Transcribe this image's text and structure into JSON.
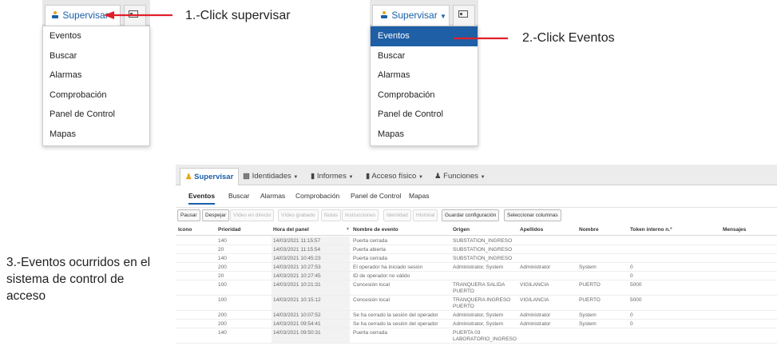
{
  "step1": {
    "supervisar_label": "Supervisar",
    "supervisar_icon": "monitor-person-icon",
    "other_icon": "id-card-icon",
    "menu": [
      "Eventos",
      "Buscar",
      "Alarmas",
      "Comprobación",
      "Panel de Control",
      "Mapas"
    ],
    "annotation": "1.-Click supervisar"
  },
  "step2": {
    "supervisar_label": "Supervisar",
    "supervisar_icon": "monitor-person-icon",
    "other_icon": "id-card-icon",
    "menu": [
      "Eventos",
      "Buscar",
      "Alarmas",
      "Comprobación",
      "Panel de Control",
      "Mapas"
    ],
    "selected_item": "Eventos",
    "annotation": "2.-Click Eventos"
  },
  "step3": {
    "annotation": "3.-Eventos ocurridos en el sistema de control de acceso"
  },
  "app": {
    "top_tabs": [
      "Supervisar",
      "Identidades",
      "Informes",
      "Acceso físico",
      "Funciones"
    ],
    "sub_tabs": [
      "Eventos",
      "Buscar",
      "Alarmas",
      "Comprobación",
      "Panel de Control",
      "Mapas"
    ],
    "toolbar": {
      "pausar": "Pausar",
      "despejar": "Despejar",
      "video_directo": "Vídeo en directo",
      "video_grabado": "Vídeo grabado",
      "notas": "Notas",
      "instrucciones": "Instrucciones",
      "identidad": "Identidad",
      "historial": "Historial",
      "guardar": "Guardar configuración",
      "seleccionar": "Seleccionar columnas"
    },
    "columns": {
      "icono": "Icono",
      "prioridad": "Prioridad",
      "hora": "Hora del panel",
      "nombre": "Nombre de evento",
      "origen": "Origen",
      "apellidos": "Apellidos",
      "nombre_p": "Nombre",
      "token": "Token interno n.º",
      "mensajes": "Mensajes"
    },
    "rows": [
      {
        "prioridad": "140",
        "hora": "14/03/2021 11:15:57",
        "evento": "Puerta cerrada",
        "origen": "SUBSTATION_INGRESO",
        "apellidos": "",
        "nombre": "",
        "token": ""
      },
      {
        "prioridad": "20",
        "hora": "14/03/2021 11:15:54",
        "evento": "Puerta abierta",
        "origen": "SUBSTATION_INGRESO",
        "apellidos": "",
        "nombre": "",
        "token": ""
      },
      {
        "prioridad": "140",
        "hora": "14/03/2021 10:45:23",
        "evento": "Puerta cerrada",
        "origen": "SUBSTATION_INGRESO",
        "apellidos": "",
        "nombre": "",
        "token": ""
      },
      {
        "prioridad": "200",
        "hora": "14/03/2021 10:27:53",
        "evento": "El operador ha iniciado sesión",
        "origen": "Administrator, System",
        "apellidos": "Administrator",
        "nombre": "System",
        "token": "0"
      },
      {
        "prioridad": "20",
        "hora": "14/03/2021 10:27:45",
        "evento": "ID de operador no válido",
        "origen": "",
        "apellidos": "",
        "nombre": "",
        "token": "0"
      },
      {
        "prioridad": "100",
        "hora": "14/03/2021 10:21:31",
        "evento": "Concesión local",
        "origen": "TRANQUERA SALIDA PUERTO",
        "apellidos": "VIGILANCIA",
        "nombre": "PUERTO",
        "token": "5000"
      },
      {
        "prioridad": "100",
        "hora": "14/03/2021 10:15:12",
        "evento": "Concesión local",
        "origen": "TRANQUERA INGRESO PUERTO",
        "apellidos": "VIGILANCIA",
        "nombre": "PUERTO",
        "token": "5000"
      },
      {
        "prioridad": "200",
        "hora": "14/03/2021 10:07:52",
        "evento": "Se ha cerrado la sesión del operador",
        "origen": "Administrator, System",
        "apellidos": "Administrator",
        "nombre": "System",
        "token": "0"
      },
      {
        "prioridad": "200",
        "hora": "14/03/2021 09:54:41",
        "evento": "Se ha cerrado la sesión del operador",
        "origen": "Administrator, System",
        "apellidos": "Administrator",
        "nombre": "System",
        "token": "0"
      },
      {
        "prioridad": "140",
        "hora": "14/03/2021 09:50:31",
        "evento": "Puerta cerrada",
        "origen": "PUERTA 03 LABORATORIO_INGRESO",
        "apellidos": "",
        "nombre": "",
        "token": ""
      }
    ]
  },
  "colors": {
    "accent": "#1f5fa5",
    "arrow": "#e0202a"
  }
}
